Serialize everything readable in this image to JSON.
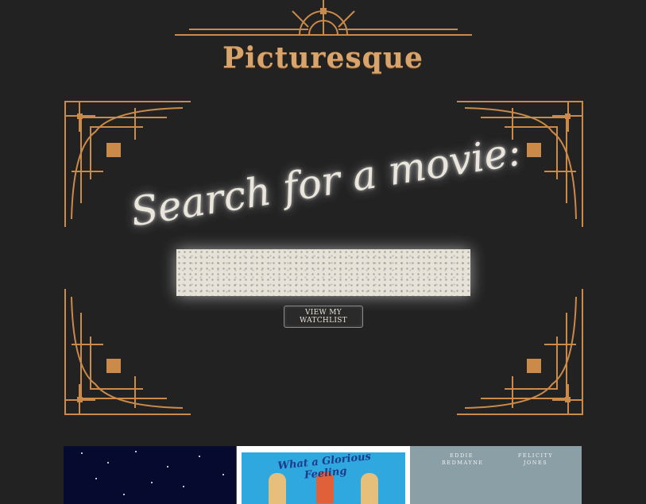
{
  "brand": {
    "name": "Picturesque"
  },
  "search": {
    "heading": "Search for a movie:",
    "placeholder": ""
  },
  "watchlist_button": {
    "label": "VIEW MY WATCHLIST"
  },
  "posters": [
    {
      "tagline": ""
    },
    {
      "title": "What a Glorious Feeling"
    },
    {
      "actor_1": "EDDIE REDMAYNE",
      "actor_2": "FELICITY JONES"
    }
  ],
  "colors": {
    "background": "#222222",
    "gold_accent": "#c98a4a",
    "brand_text": "#d9a46c"
  }
}
